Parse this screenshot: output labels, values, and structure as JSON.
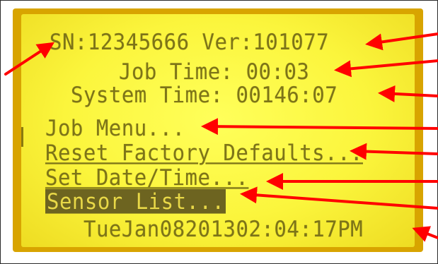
{
  "display": {
    "header_line": "SN:12345666 Ver:101077",
    "job_time": "Job Time: 00:03",
    "system_time": "System Time: 00146:07",
    "menu": [
      {
        "label": "Job Menu...",
        "selected": false
      },
      {
        "label": "Reset Factory Defaults...",
        "selected": false
      },
      {
        "label": "Set Date/Time...",
        "selected": false
      },
      {
        "label": "Sensor List...",
        "selected": true
      }
    ],
    "datetime": "TueJan08201302:04:17PM"
  },
  "colors": {
    "lcd_background": "#fbf53c",
    "lcd_text": "#7d7418",
    "highlight_background": "#6d6420",
    "annotation_arrow": "#ff0000"
  }
}
